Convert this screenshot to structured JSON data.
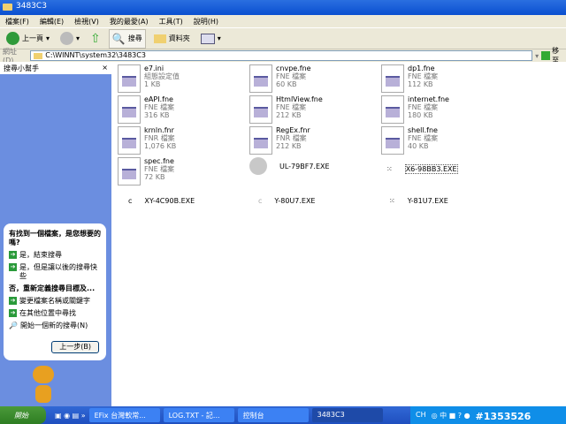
{
  "window": {
    "title": "3483C3"
  },
  "menu": [
    "檔案(F)",
    "編輯(E)",
    "檢視(V)",
    "我的最愛(A)",
    "工具(T)",
    "說明(H)"
  ],
  "toolbar": {
    "back": "上一頁",
    "search": "搜尋",
    "folders": "資料夾"
  },
  "address": {
    "label": "網址(D)",
    "value": "C:\\WINNT\\system32\\3483C3",
    "go": "移至"
  },
  "search_pane": {
    "title": "搜尋小幫手",
    "close": "×",
    "question": "有找到一個檔案，是您想要的嗎?",
    "options": [
      "是，結束搜尋",
      "是，但是讓以後的搜尋快些"
    ],
    "heading2": "否，重新定義搜尋目標及...",
    "options2": [
      "變更檔案名稱或關鍵字",
      "在其他位置中尋找"
    ],
    "new_search": "開始一個新的搜尋(N)",
    "back_button": "上一步(B)"
  },
  "files": [
    {
      "name": "e7.ini",
      "type": "組態設定值",
      "size": "1 KB"
    },
    {
      "name": "cnvpe.fne",
      "type": "FNE 檔案",
      "size": "60 KB"
    },
    {
      "name": "dp1.fne",
      "type": "FNE 檔案",
      "size": "112 KB"
    },
    {
      "name": "eAPI.fne",
      "type": "FNE 檔案",
      "size": "316 KB"
    },
    {
      "name": "HtmlView.fne",
      "type": "FNE 檔案",
      "size": "212 KB"
    },
    {
      "name": "internet.fne",
      "type": "FNE 檔案",
      "size": "180 KB"
    },
    {
      "name": "krnln.fnr",
      "type": "FNR 檔案",
      "size": "1,076 KB"
    },
    {
      "name": "RegEx.fnr",
      "type": "FNR 檔案",
      "size": "212 KB"
    },
    {
      "name": "shell.fne",
      "type": "FNE 檔案",
      "size": "40 KB"
    },
    {
      "name": "spec.fne",
      "type": "FNE 檔案",
      "size": "72 KB"
    }
  ],
  "exes": [
    "UL-79BF7.EXE",
    "X6-98BB3.EXE",
    "XY-4C90B.EXE",
    "Y-80U7.EXE",
    "Y-81U7.EXE"
  ],
  "taskbar": {
    "start": "開始",
    "tasks": [
      "EFix 台灣軟常...",
      "LOG.TXT - 記...",
      "控制台",
      "3483C3"
    ],
    "tray": "CH",
    "watermark": "#1353526"
  }
}
